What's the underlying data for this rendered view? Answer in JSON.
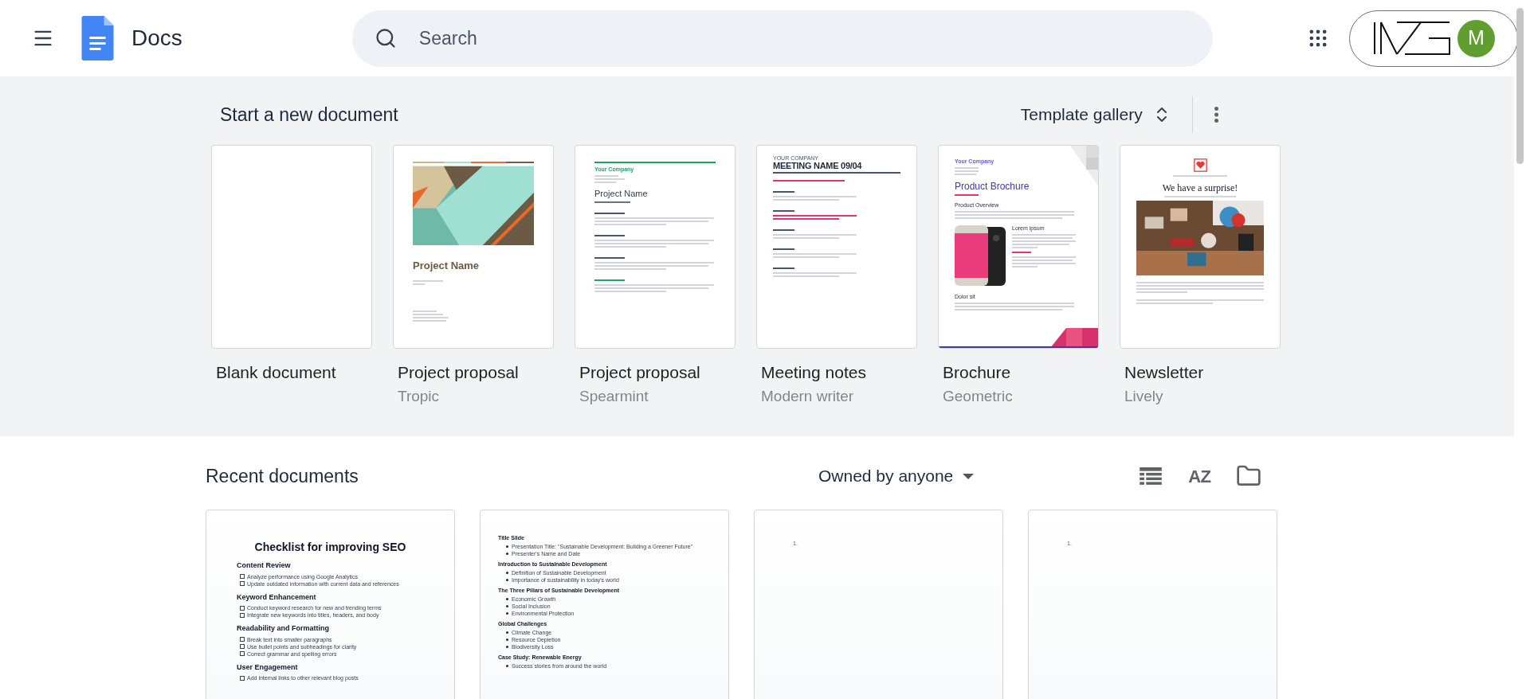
{
  "header": {
    "title": "Docs",
    "search": {
      "placeholder": "Search"
    },
    "account": {
      "initial": "M"
    }
  },
  "templates": {
    "heading": "Start a new document",
    "gallery_button": "Template gallery",
    "items": [
      {
        "kind": "blank",
        "name": "Blank document"
      },
      {
        "kind": "tropic",
        "name": "Project proposal",
        "theme": "Tropic",
        "preview": [
          "Project Name"
        ]
      },
      {
        "kind": "spearmint",
        "name": "Project proposal",
        "theme": "Spearmint",
        "preview": [
          "Your Company",
          "Project Name"
        ]
      },
      {
        "kind": "meeting",
        "name": "Meeting notes",
        "theme": "Modern writer",
        "preview": [
          "YOUR COMPANY",
          "MEETING NAME 09/04"
        ]
      },
      {
        "kind": "brochure",
        "name": "Brochure",
        "theme": "Geometric",
        "preview": [
          "Your Company",
          "Product Brochure",
          "Product Overview",
          "Lorem ipsum",
          "Dolor sit"
        ]
      },
      {
        "kind": "newsletter",
        "name": "Newsletter",
        "theme": "Lively",
        "preview": [
          "We have a surprise!"
        ]
      }
    ]
  },
  "recent": {
    "heading": "Recent documents",
    "owner_filter": "Owned by anyone",
    "sort_label": "AZ",
    "docs": [
      {
        "kind": "checklist",
        "title": "Checklist for improving SEO",
        "sections": [
          {
            "heading": "Content Review",
            "items": [
              {
                "text": "Analyze performance using Google Analytics",
                "checked": false
              },
              {
                "text": "Update outdated information with current data and references",
                "checked": false
              }
            ]
          },
          {
            "heading": "Keyword Enhancement",
            "items": [
              {
                "text": "Conduct keyword research for new and trending terms",
                "checked": false
              },
              {
                "text": "Integrate new keywords into titles, headers, and body",
                "checked": false
              }
            ]
          },
          {
            "heading": "Readability and Formatting",
            "items": [
              {
                "text": "Break text into smaller paragraphs",
                "checked": false
              },
              {
                "text": "Use bullet points and subheadings for clarity",
                "checked": false
              },
              {
                "text": "Correct grammar and spelling errors",
                "checked": false
              }
            ]
          },
          {
            "heading": "User Engagement",
            "items": [
              {
                "text": "Add internal links to other relevant blog posts",
                "checked": false
              }
            ]
          }
        ]
      },
      {
        "kind": "bullets",
        "sections": [
          {
            "heading": "Title Slide",
            "items": [
              "Presentation Title: \"Sustainable Development: Building a Greener Future\"",
              "Presenter's Name and Date"
            ]
          },
          {
            "heading": "Introduction to Sustainable Development",
            "items": [
              "Definition of Sustainable Development",
              "Importance of sustainability in today's world"
            ]
          },
          {
            "heading": "The Three Pillars of Sustainable Development",
            "items": [
              "Economic Growth",
              "Social Inclusion",
              "Environmental Protection"
            ]
          },
          {
            "heading": "Global Challenges",
            "items": [
              "Climate Change",
              "Resource Depletion",
              "Biodiversity Loss"
            ]
          },
          {
            "heading": "Case Study: Renewable Energy",
            "items": [
              "Success stories from around the world"
            ]
          }
        ]
      },
      {
        "kind": "numbered",
        "lines": [
          "1."
        ]
      },
      {
        "kind": "numbered",
        "lines": [
          "1."
        ]
      }
    ]
  }
}
